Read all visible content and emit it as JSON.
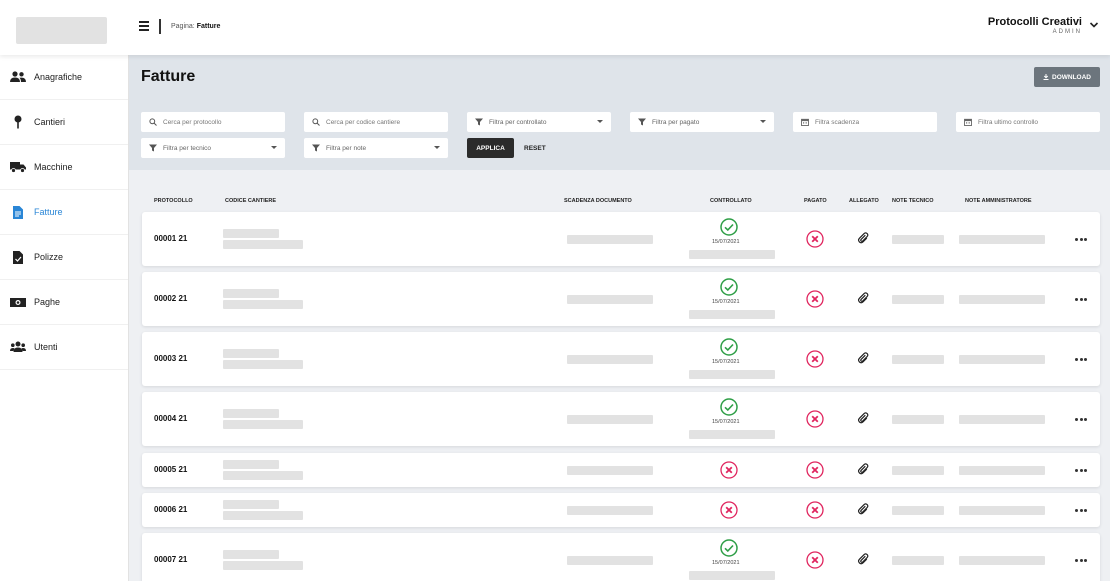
{
  "header": {
    "breadcrumb_prefix": "Pagina:",
    "breadcrumb_page": "Fatture",
    "user_name": "Protocolli Creativi",
    "user_role": "ADMIN"
  },
  "sidebar": {
    "items": [
      {
        "label": "Anagrafiche",
        "icon": "users-icon",
        "active": false
      },
      {
        "label": "Cantieri",
        "icon": "map-pin-icon",
        "active": false
      },
      {
        "label": "Macchine",
        "icon": "truck-icon",
        "active": false
      },
      {
        "label": "Fatture",
        "icon": "invoice-icon",
        "active": true
      },
      {
        "label": "Polizze",
        "icon": "policy-document-icon",
        "active": false
      },
      {
        "label": "Paghe",
        "icon": "money-icon",
        "active": false
      },
      {
        "label": "Utenti",
        "icon": "user-group-icon",
        "active": false
      }
    ]
  },
  "page": {
    "title": "Fatture",
    "download_label": "DOWNLOAD"
  },
  "filters": {
    "protocollo_placeholder": "Cerca per protocollo",
    "codice_cantiere_placeholder": "Cerca per codice cantiere",
    "controllato_placeholder": "Filtra per controllato",
    "pagato_placeholder": "Filtra per pagato",
    "scadenza_placeholder": "Filtra scadenza",
    "ultimo_controllo_placeholder": "Filtra ultimo controllo",
    "tecnico_placeholder": "Filtra per tecnico",
    "note_placeholder": "Filtra per note",
    "apply_label": "APPLICA",
    "reset_label": "RESET"
  },
  "table": {
    "columns": [
      "PROTOCOLLO",
      "CODICE CANTIERE",
      "SCADENZA DOCUMENTO",
      "CONTROLLATO",
      "PAGATO",
      "ALLEGATO",
      "NOTE TECNICO",
      "NOTE AMMINISTRATORE"
    ],
    "rows": [
      {
        "protocollo": "00001 21",
        "controllato": true,
        "data_controllo": "15/07/2021",
        "pagato": false,
        "allegato": true
      },
      {
        "protocollo": "00002 21",
        "controllato": true,
        "data_controllo": "15/07/2021",
        "pagato": false,
        "allegato": true
      },
      {
        "protocollo": "00003 21",
        "controllato": true,
        "data_controllo": "15/07/2021",
        "pagato": false,
        "allegato": true
      },
      {
        "protocollo": "00004 21",
        "controllato": true,
        "data_controllo": "15/07/2021",
        "pagato": false,
        "allegato": true
      },
      {
        "protocollo": "00005 21",
        "controllato": false,
        "data_controllo": "",
        "pagato": false,
        "allegato": true
      },
      {
        "protocollo": "00006 21",
        "controllato": false,
        "data_controllo": "",
        "pagato": false,
        "allegato": true
      },
      {
        "protocollo": "00007 21",
        "controllato": true,
        "data_controllo": "15/07/2021",
        "pagato": false,
        "allegato": true
      }
    ]
  },
  "colors": {
    "accent": "#2a86d6",
    "check_green": "#2e9e46",
    "cross_red": "#e0245e",
    "dark_button": "#2b2b2b",
    "download_button": "#6c757d"
  }
}
